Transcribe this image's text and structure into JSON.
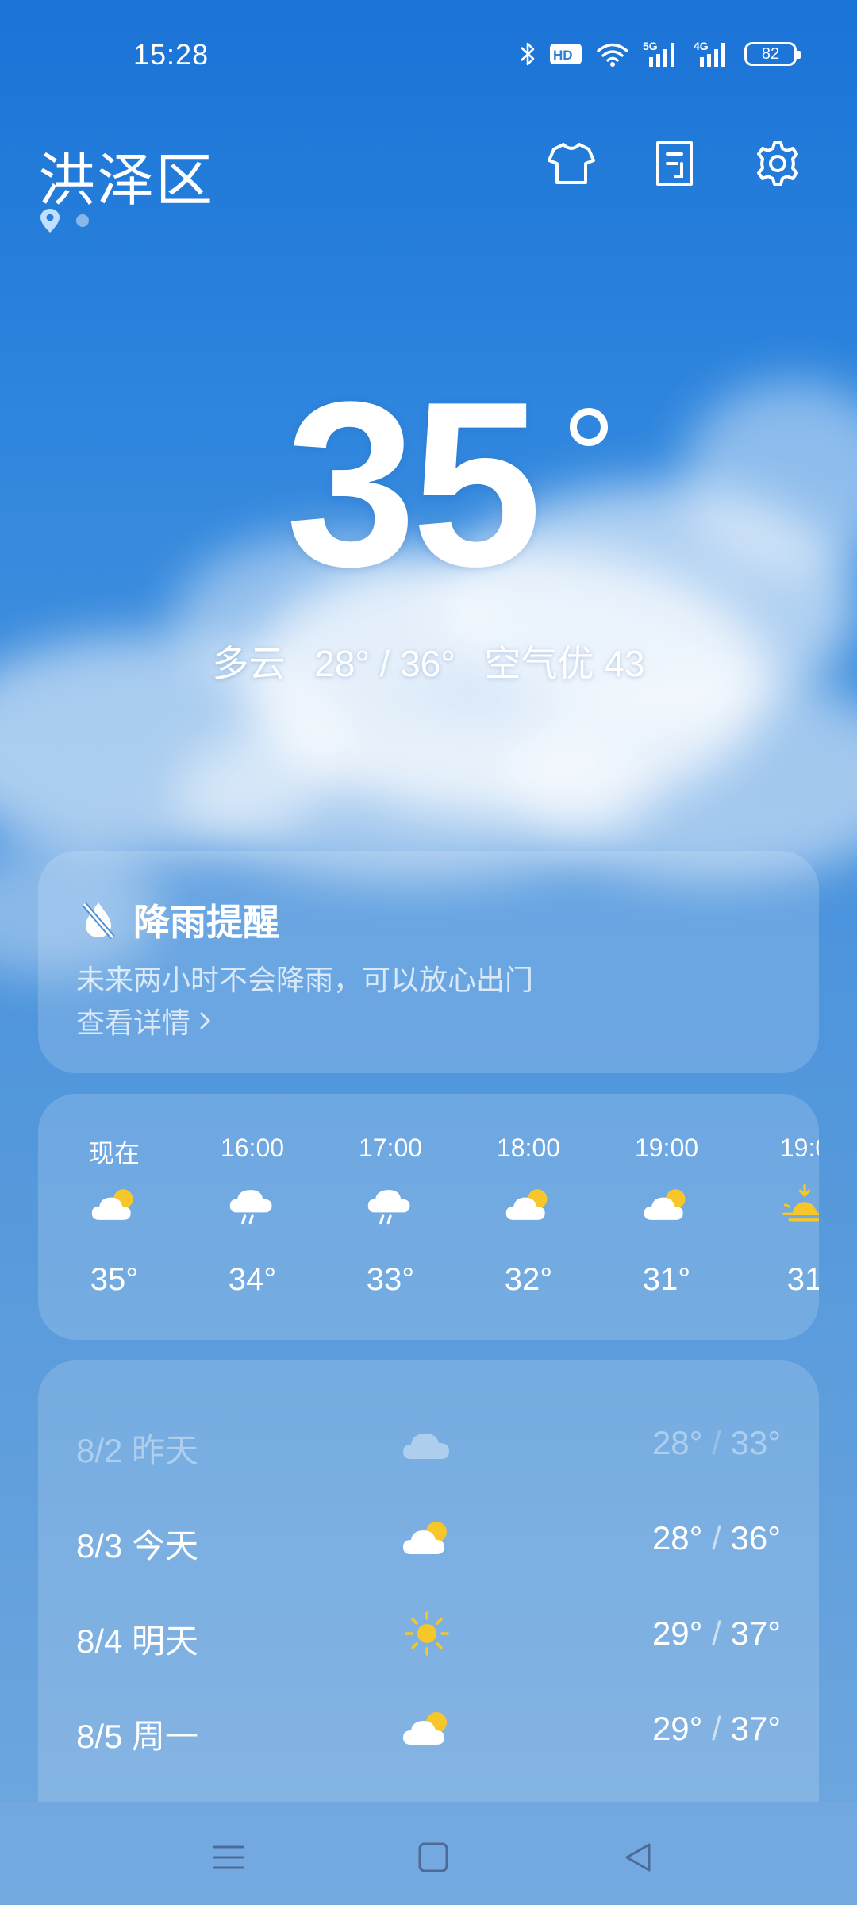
{
  "status_bar": {
    "time": "15:28",
    "battery": "82",
    "net_5g": "5G",
    "net_4g": "4G",
    "hd": "HD"
  },
  "location": {
    "city": "洪泽区"
  },
  "current": {
    "temperature": "35",
    "condition": "多云",
    "range": "28° / 36°",
    "air_quality": "空气优 43"
  },
  "rain_alert": {
    "title": "降雨提醒",
    "description": "未来两小时不会降雨，可以放心出门",
    "link": "查看详情"
  },
  "hourly": [
    {
      "time": "现在",
      "icon": "partly-cloudy-icon",
      "temp": "35°"
    },
    {
      "time": "16:00",
      "icon": "rain-icon",
      "temp": "34°"
    },
    {
      "time": "17:00",
      "icon": "rain-icon",
      "temp": "33°"
    },
    {
      "time": "18:00",
      "icon": "partly-cloudy-icon",
      "temp": "32°"
    },
    {
      "time": "19:00",
      "icon": "partly-cloudy-icon",
      "temp": "31°"
    },
    {
      "time": "19:0",
      "icon": "sunset-icon",
      "temp": "31"
    }
  ],
  "daily": [
    {
      "date": "8/2",
      "label": "昨天",
      "icon": "cloudy-icon",
      "low": "28°",
      "high": "33°",
      "past": true
    },
    {
      "date": "8/3",
      "label": "今天",
      "icon": "partly-cloudy-icon",
      "low": "28°",
      "high": "36°",
      "past": false
    },
    {
      "date": "8/4",
      "label": "明天",
      "icon": "sunny-icon",
      "low": "29°",
      "high": "37°",
      "past": false
    },
    {
      "date": "8/5",
      "label": "周一",
      "icon": "partly-cloudy-icon",
      "low": "29°",
      "high": "37°",
      "past": false
    }
  ],
  "colors": {
    "sun": "#f7c62b",
    "background_top": "#1a73d6",
    "background_bottom": "#70a8de"
  }
}
